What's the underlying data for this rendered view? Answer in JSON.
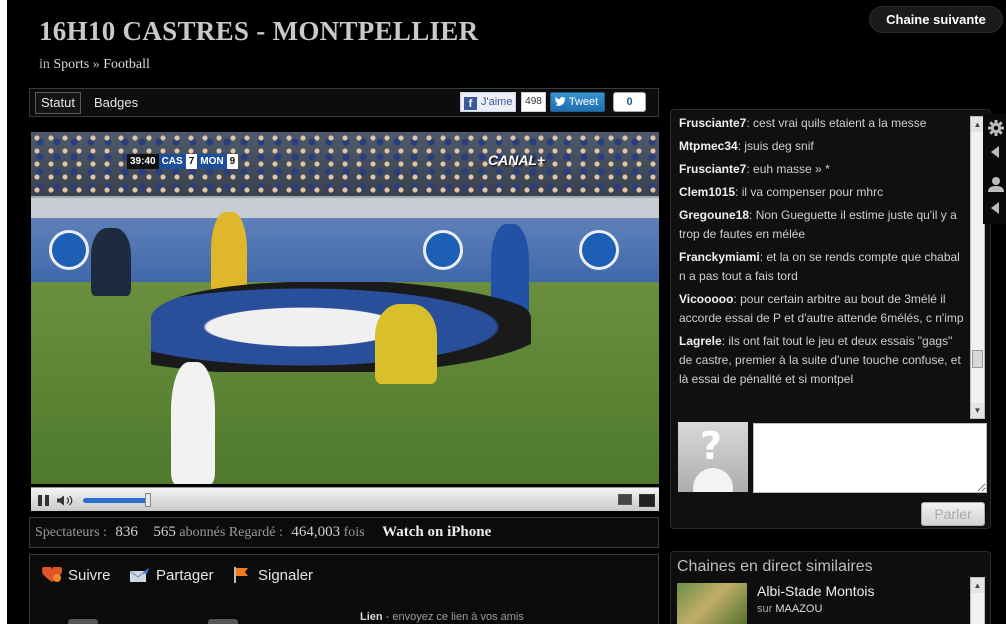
{
  "header": {
    "title": "16H10 CASTRES - MONTPELLIER",
    "in_label": "in",
    "category": "Sports",
    "separator": "»",
    "subcategory": "Football",
    "next_channel": "Chaine suivante"
  },
  "tabs": {
    "statut": "Statut",
    "badges": "Badges"
  },
  "social": {
    "like_label": "J'aime",
    "like_count": "498",
    "tweet_label": "Tweet",
    "tweet_count": "0"
  },
  "video": {
    "clock": "39:40",
    "home_team": "CAS",
    "home_score": "7",
    "away_team": "MON",
    "away_score": "9",
    "broadcaster": "CANAL+",
    "volume": 0.95
  },
  "stats": {
    "viewers_label": "Spectateurs :",
    "viewers": "836",
    "subscribers": "565",
    "subscribers_label": "abonnés",
    "watched_label": "Regardé :",
    "watched": "464,003",
    "watched_suffix": "fois",
    "iphone": "Watch on iPhone"
  },
  "actions": {
    "follow": "Suivre",
    "share": "Partager",
    "report": "Signaler",
    "link_label": "Lien",
    "link_text": "- envoyez ce lien à vos amis"
  },
  "chat": {
    "messages": [
      {
        "user": "Frusciante7",
        "text": ": cest vrai quils etaient a la messe"
      },
      {
        "user": "Mtpmec34",
        "text": ": jsuis deg snif"
      },
      {
        "user": "Frusciante7",
        "text": ": euh masse » *"
      },
      {
        "user": "Clem1015",
        "text": ": il va compenser pour mhrc"
      },
      {
        "user": "Gregoune18",
        "text": ": Non Gueguette il estime juste qu'il y a trop de fautes en mélée"
      },
      {
        "user": "Franckymiami",
        "text": ": et la on se rends compte que chabal n a pas tout a fais tord"
      },
      {
        "user": "Vicooooo",
        "text": ": pour certain arbitre au bout de 3mélé il accorde essai de P et d'autre attende 6mélés, c n'imp"
      },
      {
        "user": "Lagrele",
        "text": ": ils ont fait tout le jeu et deux essais \"gags\" de castre, premier à la suite d'une touche confuse, et là essai de pénalité et si montpel"
      }
    ],
    "submit": "Parler"
  },
  "similar": {
    "title": "Chaines en direct similaires",
    "items": [
      {
        "name": "Albi-Stade Montois",
        "by_label": "sur",
        "owner": "MAAZOU"
      }
    ]
  },
  "colors": {
    "background": "#000000",
    "tweet_blue": "#2a7fbd",
    "facebook_blue": "#3b5998",
    "volume_blue": "#2c6fd0"
  }
}
